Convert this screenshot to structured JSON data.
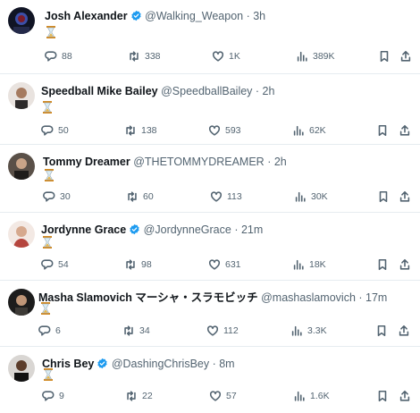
{
  "tweets": [
    {
      "name": "Josh Alexander",
      "verified": true,
      "handle": "@Walking_Weapon",
      "time": "· 3h",
      "content_icon": "hourglass-emoji",
      "replies": "88",
      "retweets": "338",
      "likes": "1K",
      "views": "389K"
    },
    {
      "name": "Speedball Mike Bailey",
      "verified": false,
      "handle": "@SpeedballBailey",
      "time": "· 2h",
      "content_icon": "hourglass-emoji",
      "replies": "50",
      "retweets": "138",
      "likes": "593",
      "views": "62K"
    },
    {
      "name": "Tommy Dreamer",
      "verified": false,
      "handle": "@THETOMMYDREAMER",
      "time": "· 2h",
      "content_icon": "hourglass-emoji",
      "replies": "30",
      "retweets": "60",
      "likes": "113",
      "views": "30K"
    },
    {
      "name": "Jordynne Grace",
      "verified": true,
      "handle": "@JordynneGrace",
      "time": "· 21m",
      "content_icon": "hourglass-emoji",
      "replies": "54",
      "retweets": "98",
      "likes": "631",
      "views": "18K"
    },
    {
      "name": "Masha Slamovich マーシャ・スラモビッチ",
      "verified": false,
      "handle": "@mashaslamovich",
      "time": "· 17m",
      "content_icon": "hourglass-emoji",
      "replies": "6",
      "retweets": "34",
      "likes": "112",
      "views": "3.3K"
    },
    {
      "name": "Chris Bey",
      "verified": true,
      "handle": "@DashingChrisBey",
      "time": "· 8m",
      "content_icon": "hourglass-emoji",
      "replies": "9",
      "retweets": "22",
      "likes": "57",
      "views": "1.6K"
    }
  ],
  "colors": {
    "text": "#0f1419",
    "secondary": "#536471",
    "verified_blue": "#1d9bf0",
    "divider": "#e6ecf0"
  }
}
